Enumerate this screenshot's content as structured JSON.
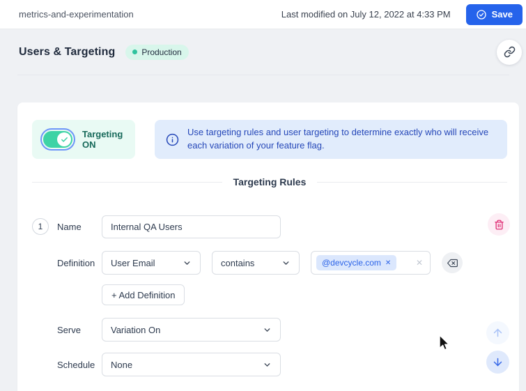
{
  "header": {
    "project_name": "metrics-and-experimentation",
    "last_modified": "Last modified on July 12, 2022 at 4:33 PM",
    "save_button": "Save"
  },
  "page_header": {
    "title": "Users & Targeting",
    "environment_badge": "Production"
  },
  "targeting_panel": {
    "toggle_label": "Targeting ON",
    "info_banner": "Use targeting rules and user targeting to determine exactly who will receive each variation of your feature flag.",
    "section_heading": "Targeting Rules"
  },
  "rules": [
    {
      "number": "1",
      "name_label": "Name",
      "name_value": "Internal QA Users",
      "definition_label": "Definition",
      "property_selected": "User Email",
      "comparator_selected": "contains",
      "tag_values": [
        "@devcycle.com"
      ],
      "add_definition_button": "+ Add Definition",
      "serve_label": "Serve",
      "serve_selected": "Variation On",
      "schedule_label": "Schedule",
      "schedule_selected": "None"
    }
  ],
  "glyphs": {
    "tag_remove": "✕",
    "clear_field": "✕"
  },
  "icons": {
    "save": "check-circle",
    "share": "link-chain",
    "banner": "info-circle",
    "toggle_state": "check",
    "delete_rule": "trash",
    "clear_values": "backspace",
    "reorder_up": "arrow-up",
    "reorder_down": "arrow-down",
    "dropdowns": "chevron-down"
  },
  "colors": {
    "accent_blue": "#2563eb",
    "toggle_teal": "#3ed3a5",
    "badge_mint_bg": "#d8f6eb",
    "toggle_card_bg": "#e9faf4",
    "info_bg": "#e1ecfc",
    "info_text": "#2547b8",
    "danger_pink": "#df2a72",
    "page_bg": "#eff1f4"
  }
}
